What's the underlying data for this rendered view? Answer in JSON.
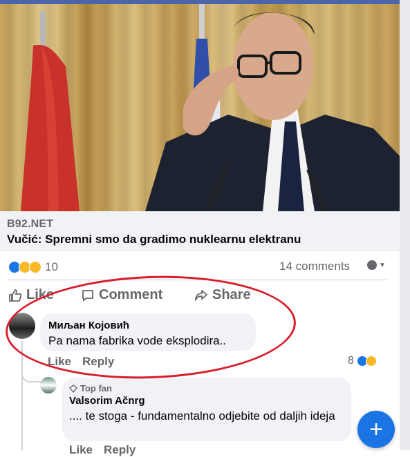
{
  "post": {
    "link": {
      "domain": "B92.NET",
      "title": "Vučić: Spremni smo da gradimo nuklearnu elektranu"
    },
    "reactions": {
      "icons": [
        "like-icon",
        "haha-icon",
        "wow-icon"
      ],
      "count": "10"
    },
    "comments_count": "14 comments",
    "actions": {
      "like": "Like",
      "comment": "Comment",
      "share": "Share"
    }
  },
  "comments": [
    {
      "author": "Миљан Којовић",
      "text": "Pa nama fabrika vode eksplodira..",
      "like_label": "Like",
      "reply_label": "Reply",
      "reaction_count": "8"
    },
    {
      "badge": "Top fan",
      "author": "Valsorim Ačnrg",
      "text": ".... te stoga - fundamentalno odjebite od daljih ideja",
      "like_label": "Like",
      "reply_label": "Reply"
    }
  ],
  "fab_label": "+",
  "colors": {
    "accent": "#1b74e4",
    "highlight_ring": "#d81e2c",
    "muted_text": "#65676b",
    "bubble_bg": "#f0f2f5"
  }
}
